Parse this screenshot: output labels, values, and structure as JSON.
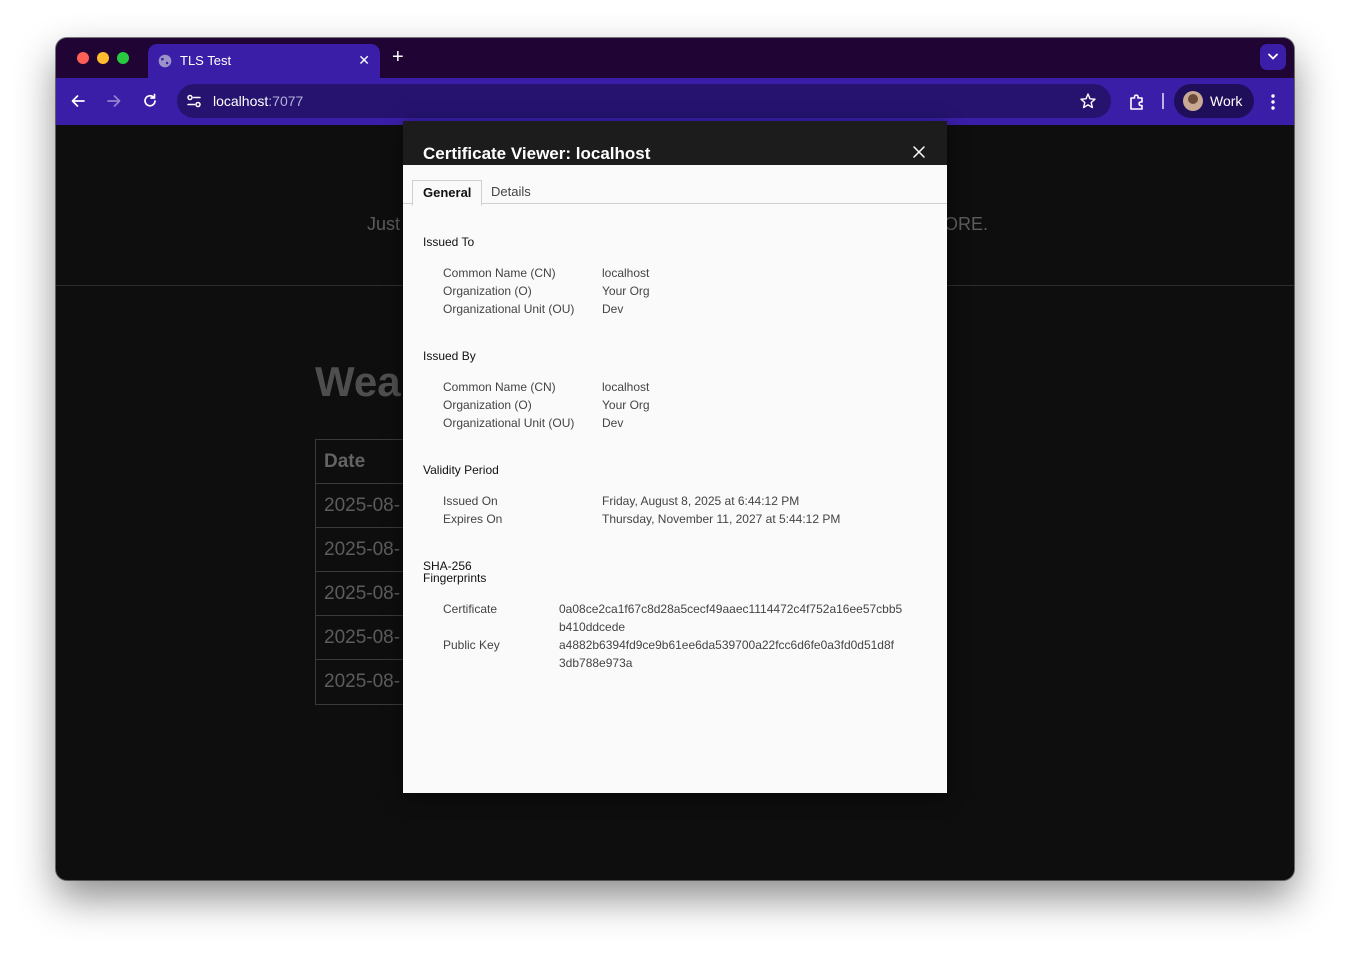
{
  "browser": {
    "tab_title": "TLS Test",
    "tab_close_icon": "close-icon",
    "new_tab_icon": "plus-icon",
    "url_host": "localhost",
    "url_port": ":7077",
    "profile_label": "Work"
  },
  "page": {
    "banner_left": "Just",
    "banner_right": "ORE.",
    "heading": "Wea",
    "table_header": "Date",
    "table_rows": [
      "2025-08-",
      "2025-08-",
      "2025-08-",
      "2025-08-",
      "2025-08-"
    ]
  },
  "dialog": {
    "title": "Certificate Viewer: localhost",
    "tabs": [
      "General",
      "Details"
    ],
    "issued_to": {
      "heading": "Issued To",
      "cn_label": "Common Name (CN)",
      "cn_value": "localhost",
      "o_label": "Organization (O)",
      "o_value": "Your Org",
      "ou_label": "Organizational Unit (OU)",
      "ou_value": "Dev"
    },
    "issued_by": {
      "heading": "Issued By",
      "cn_label": "Common Name (CN)",
      "cn_value": "localhost",
      "o_label": "Organization (O)",
      "o_value": "Your Org",
      "ou_label": "Organizational Unit (OU)",
      "ou_value": "Dev"
    },
    "validity": {
      "heading": "Validity Period",
      "issued_label": "Issued On",
      "issued_value": "Friday, August 8, 2025 at 6:44:12 PM",
      "expires_label": "Expires On",
      "expires_value": "Thursday, November 11, 2027 at 5:44:12 PM"
    },
    "fingerprints": {
      "heading_line1": "SHA-256",
      "heading_line2": "Fingerprints",
      "cert_label": "Certificate",
      "cert_value_line1": "0a08ce2ca1f67c8d28a5cecf49aaec1114472c4f752a16ee57cbb5",
      "cert_value_line2": "b410ddcede",
      "pubkey_label": "Public Key",
      "pubkey_value_line1": "a4882b6394fd9ce9b61ee6da539700a22fcc6d6fe0a3fd0d51d8f",
      "pubkey_value_line2": "3db788e973a"
    }
  }
}
